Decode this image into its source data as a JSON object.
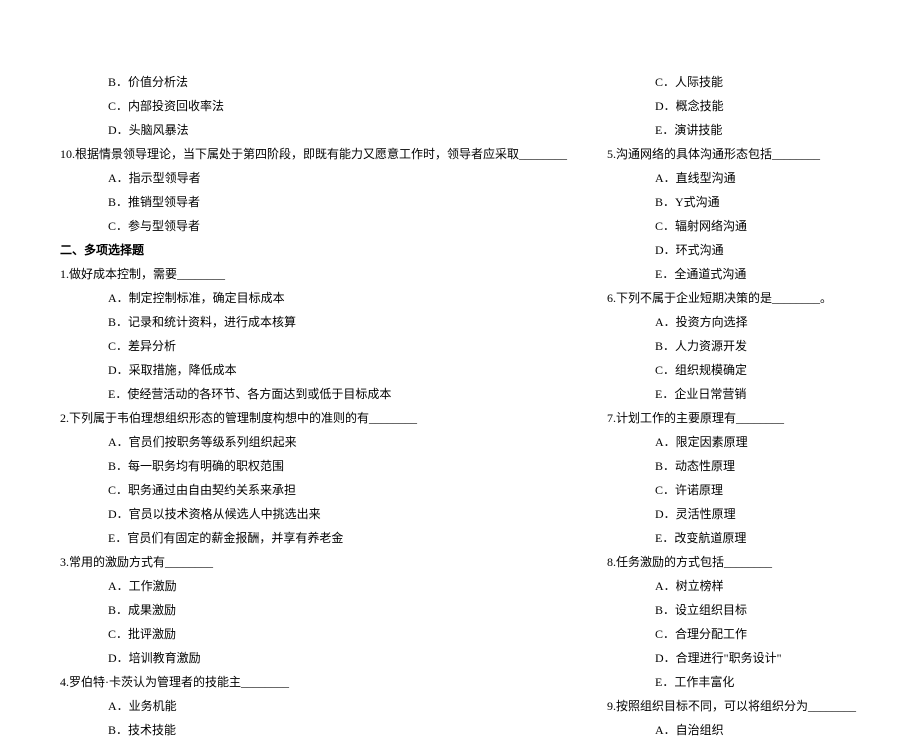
{
  "col1": {
    "l1": "B．价值分析法",
    "l2": "C．内部投资回收率法",
    "l3": "D．头脑风暴法",
    "l4": "10.根据情景领导理论，当下属处于第四阶段，即既有能力又愿意工作时，领导者应采取________",
    "l5": "A．指示型领导者",
    "l6": "B．推销型领导者",
    "l7": "C．参与型领导者",
    "l8": "二、多项选择题",
    "l9": "1.做好成本控制，需要________",
    "l10": "A．制定控制标准，确定目标成本",
    "l11": "B．记录和统计资料，进行成本核算",
    "l12": "C．差异分析",
    "l13": "D．采取措施，降低成本",
    "l14": "E．使经营活动的各环节、各方面达到或低于目标成本",
    "l15": "2.下列属于韦伯理想组织形态的管理制度构想中的准则的有________",
    "l16": "A．官员们按职务等级系列组织起来",
    "l17": "B．每一职务均有明确的职权范围",
    "l18": "C．职务通过由自由契约关系来承担",
    "l19": "D．官员以技术资格从候选人中挑选出来",
    "l20": "E．官员们有固定的薪金报酬，并享有养老金",
    "l21": "3.常用的激励方式有________",
    "l22": "A．工作激励",
    "l23": "B．成果激励",
    "l24": "C．批评激励",
    "l25": "D．培训教育激励",
    "l26": "4.罗伯特·卡茨认为管理者的技能主________",
    "l27": "A．业务机能",
    "l28": "B．技术技能"
  },
  "col2": {
    "l1": "C．人际技能",
    "l2": "D．概念技能",
    "l3": "E．演讲技能",
    "l4": "5.沟通网络的具体沟通形态包括________",
    "l5": "A．直线型沟通",
    "l6": "B．Y式沟通",
    "l7": "C．辐射网络沟通",
    "l8": "D．环式沟通",
    "l9": "E．全通道式沟通",
    "l10": "6.下列不属于企业短期决策的是________。",
    "l11": "A．投资方向选择",
    "l12": "B．人力资源开发",
    "l13": "C．组织规模确定",
    "l14": "E．企业日常营销",
    "l15": "7.计划工作的主要原理有________",
    "l16": "A．限定因素原理",
    "l17": "B．动态性原理",
    "l18": "C．许诺原理",
    "l19": "D．灵活性原理",
    "l20": "E．改变航道原理",
    "l21": "8.任务激励的方式包括________",
    "l22": "A．树立榜样",
    "l23": "B．设立组织目标",
    "l24": "C．合理分配工作",
    "l25": "D．合理进行\"职务设计\"",
    "l26": "E．工作丰富化",
    "l27": "9.按照组织目标不同，可以将组织分为________",
    "l28": "A．自治组织"
  }
}
